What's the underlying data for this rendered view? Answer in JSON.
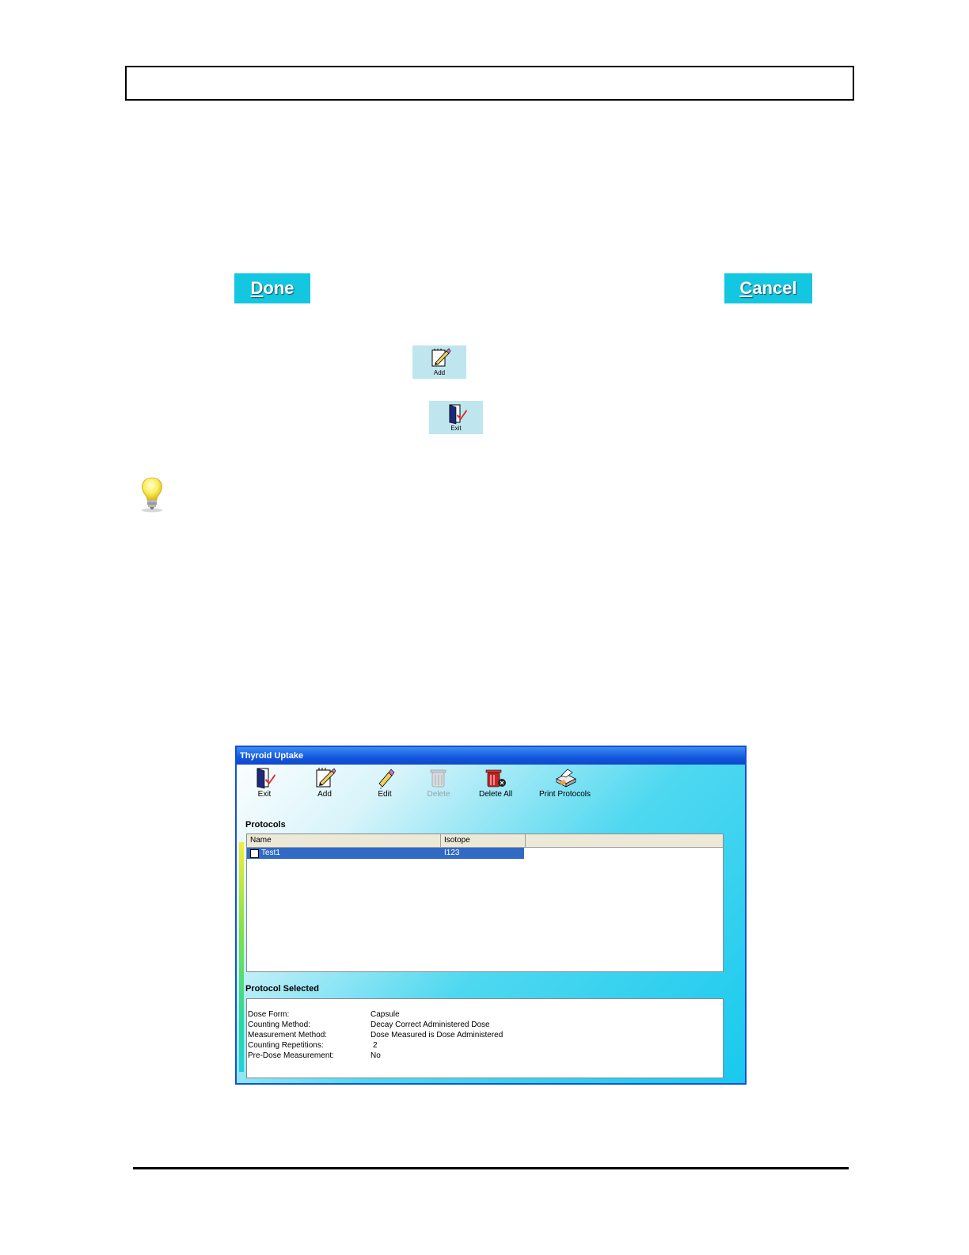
{
  "buttons": {
    "done": {
      "prefix": "D",
      "rest": "one"
    },
    "cancel": {
      "prefix": "C",
      "rest": "ancel"
    }
  },
  "mini_buttons": {
    "add_label": "Add",
    "exit_label": "Exit",
    "add_icon": "pencil-pad-icon",
    "exit_icon": "exit-door-icon"
  },
  "tip_icon": "lightbulb-icon",
  "dialog": {
    "title": "Thyroid Uptake",
    "toolbar": [
      {
        "label": "Exit",
        "icon": "exit-door-icon"
      },
      {
        "label": "Add",
        "icon": "pencil-pad-icon"
      },
      {
        "label": "Edit",
        "icon": "eraser-pencil-icon"
      },
      {
        "label": "Delete",
        "icon": "trash-can-icon",
        "disabled": true
      },
      {
        "label": "Delete All",
        "icon": "delete-all-icon"
      },
      {
        "label": "Print Protocols",
        "icon": "printer-icon"
      }
    ],
    "protocols_label": "Protocols",
    "columns": [
      "Name",
      "Isotope"
    ],
    "rows": [
      {
        "name": "Test1",
        "isotope": "I123",
        "selected": true
      }
    ],
    "protocol_selected_label": "Protocol Selected",
    "details": [
      {
        "label": "Dose Form:",
        "value": "Capsule"
      },
      {
        "label": "Counting Method:",
        "value": "Decay Correct Administered Dose"
      },
      {
        "label": "Measurement Method:",
        "value": "Dose Measured is Dose Administered"
      },
      {
        "label": "Counting Repetitions:",
        "value": "2"
      },
      {
        "label": "Pre-Dose Measurement:",
        "value": "No"
      }
    ]
  },
  "colors": {
    "cyan_button": "#14c7e0",
    "title_bar": "#1356e0",
    "selection": "#316ac5"
  }
}
